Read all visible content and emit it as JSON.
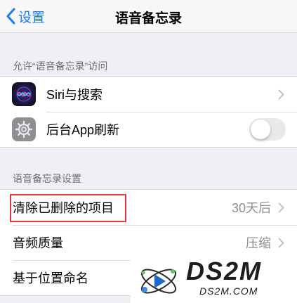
{
  "navbar": {
    "back_label": "设置",
    "title": "语音备忘录"
  },
  "sections": {
    "access_header": "允许“语音备忘录”访问",
    "settings_header": "语音备忘录设置"
  },
  "access_rows": [
    {
      "label": "Siri与搜索",
      "icon": "siri-icon"
    },
    {
      "label": "后台App刷新",
      "icon": "gear-icon",
      "toggle_on": false
    }
  ],
  "settings_rows": [
    {
      "label": "清除已删除的项目",
      "value": "30天后"
    },
    {
      "label": "音频质量",
      "value": "压缩"
    },
    {
      "label": "基于位置命名"
    }
  ],
  "watermark": {
    "brand": "DS2M",
    "url": "DS2M.COM"
  },
  "colors": {
    "accent": "#1a7cf3",
    "highlight": "#e03a3a"
  }
}
